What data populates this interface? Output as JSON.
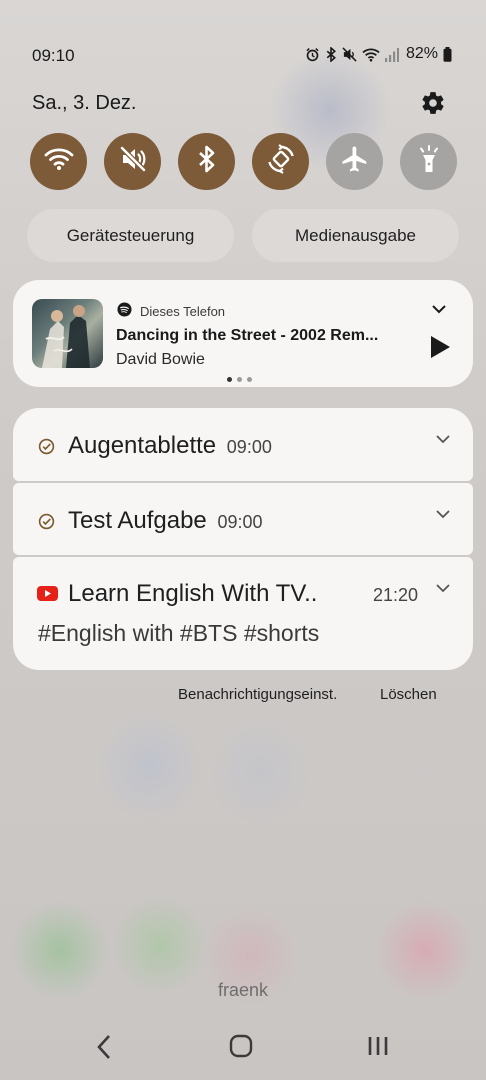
{
  "status_bar": {
    "time": "09:10",
    "battery": "82%",
    "icons": [
      "alarm-icon",
      "bluetooth-icon",
      "mute-icon",
      "wifi-icon",
      "signal-icon",
      "battery-icon"
    ]
  },
  "header": {
    "date": "Sa., 3. Dez.",
    "settings_icon": "gear-icon"
  },
  "quick_toggles": [
    {
      "name": "wifi",
      "icon": "wifi-icon",
      "active": true
    },
    {
      "name": "mute",
      "icon": "mute-icon",
      "active": true
    },
    {
      "name": "bluetooth",
      "icon": "bluetooth-icon",
      "active": true
    },
    {
      "name": "auto-rotate",
      "icon": "auto-rotate-icon",
      "active": true
    },
    {
      "name": "airplane",
      "icon": "airplane-icon",
      "active": false
    },
    {
      "name": "flashlight",
      "icon": "flashlight-icon",
      "active": false
    }
  ],
  "pills": {
    "device_control": "Gerätesteuerung",
    "media_output": "Medienausgabe"
  },
  "media": {
    "source": "Dieses Telefon",
    "title": "Dancing in the Street - 2002 Rem...",
    "artist": "David Bowie",
    "page_count": 3,
    "active_page": 1
  },
  "notifications": [
    {
      "title": "Augentablette",
      "time": "09:00",
      "icon": "check-icon"
    },
    {
      "title": "Test Aufgabe",
      "time": "09:00",
      "icon": "check-icon"
    },
    {
      "title": "Learn English With TV..",
      "time": "21:20",
      "body": "#English with #BTS #shorts",
      "icon": "youtube-icon"
    }
  ],
  "actions": {
    "settings": "Benachrichtigungseinst.",
    "clear": "Löschen"
  },
  "carrier": "fraenk",
  "colors": {
    "toggle_on": "#7d5a38",
    "toggle_off": "#a6a4a3",
    "card": "#f7f6f5",
    "youtube": "#e62117"
  }
}
